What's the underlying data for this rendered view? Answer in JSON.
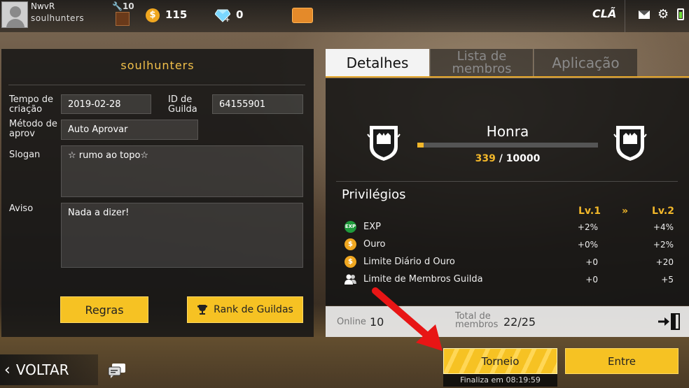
{
  "topbar": {
    "player_name": "NwvR",
    "player_guild": "soulhunters",
    "level": "10",
    "coins": "115",
    "diamonds": "0",
    "section_title": "CLÃ"
  },
  "guild": {
    "name": "soulhunters",
    "labels": {
      "created": "Tempo de criação",
      "guild_id": "ID de Guilda",
      "approval": "Método de aprov",
      "slogan": "Slogan",
      "notice": "Aviso"
    },
    "created_value": "2019-02-28",
    "guild_id_value": "64155901",
    "approval_value": "Auto Aprovar",
    "slogan_value": "☆ rumo ao topo☆",
    "notice_value": "Nada a dizer!",
    "rules_label": "Regras",
    "rank_label": "Rank de Guildas"
  },
  "tabs": {
    "details": "Detalhes",
    "members": "Lista de membros",
    "application": "Aplicação"
  },
  "honor": {
    "label": "Honra",
    "current": "339",
    "max": " / 10000",
    "progress": 0.0339
  },
  "privileges": {
    "title": "Privilégios",
    "lv1": "Lv.1",
    "sep": "»",
    "lv2": "Lv.2",
    "rows": [
      {
        "icon": "exp-icon",
        "label": "EXP",
        "v1": "+2%",
        "v2": "+4%"
      },
      {
        "icon": "gold-coin-icon",
        "label": "Ouro",
        "v1": "+0%",
        "v2": "+2%"
      },
      {
        "icon": "gold-coin-icon",
        "label": "Limite Diário d Ouro",
        "v1": "+0",
        "v2": "+20"
      },
      {
        "icon": "members-icon",
        "label": "Limite de Membros Guilda",
        "v1": "+0",
        "v2": "+5"
      }
    ]
  },
  "members_info": {
    "online_label": "Online",
    "online_value": "10",
    "total_label": "Total de membros",
    "total_value": "22/25"
  },
  "bottom": {
    "back_label": "VOLTAR",
    "tournament_label": "Torneio",
    "tournament_sub": "Finaliza em 08:19:59",
    "enter_label": "Entre"
  },
  "colors": {
    "accent_yellow": "#f6c223",
    "gold_text": "#f2b72a",
    "arrow_red": "#e81515"
  }
}
